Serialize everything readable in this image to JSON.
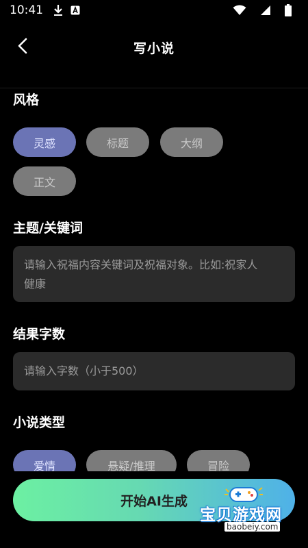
{
  "status": {
    "time": "10:41"
  },
  "header": {
    "title": "写小说"
  },
  "style_section": {
    "title": "风格",
    "chips": [
      {
        "label": "灵感",
        "active": true
      },
      {
        "label": "标题",
        "active": false
      },
      {
        "label": "大纲",
        "active": false
      },
      {
        "label": "正文",
        "active": false
      }
    ]
  },
  "keyword_section": {
    "title": "主题/关键词",
    "placeholder_line1": "请输入祝福内容关键词及祝福对象。比如:祝家人",
    "placeholder_line2": "健康"
  },
  "wordcount_section": {
    "title": "结果字数",
    "placeholder": "请输入字数（小于500）"
  },
  "type_section": {
    "title": "小说类型",
    "chips": [
      {
        "label": "爱情",
        "active": true
      },
      {
        "label": "悬疑/推理",
        "active": false
      },
      {
        "label": "冒险",
        "active": false
      }
    ]
  },
  "cta": {
    "label": "开始AI生成"
  },
  "watermark": {
    "text": "宝贝游戏网",
    "url": "baobeiy.com"
  },
  "colors": {
    "accent": "#6b74b5",
    "chip": "#7b7b7b",
    "input_bg": "#2b2b2b"
  }
}
